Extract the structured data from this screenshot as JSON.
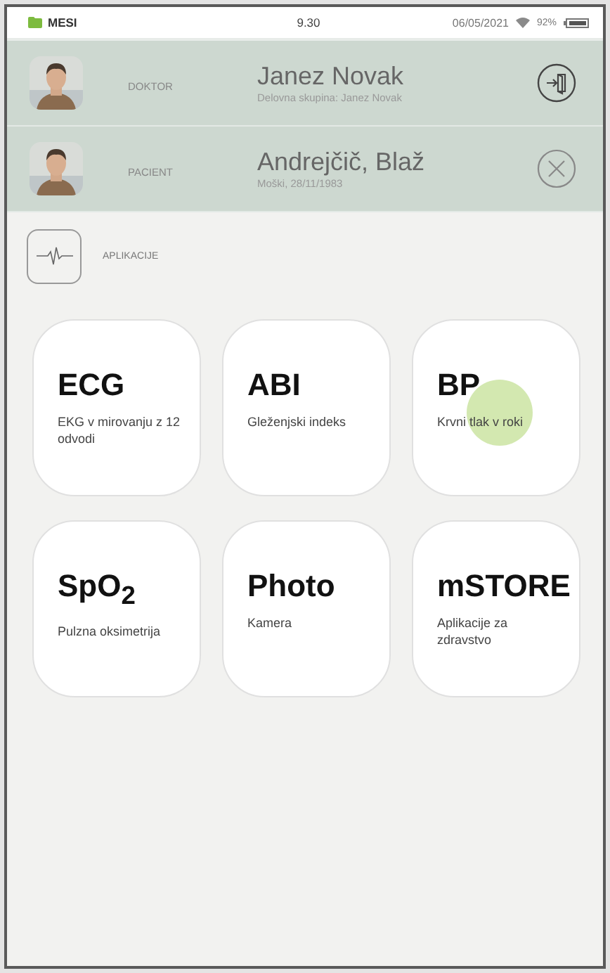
{
  "status_bar": {
    "brand": "MESI",
    "time": "9.30",
    "date": "06/05/2021",
    "battery": "92%"
  },
  "users": [
    {
      "role": "DOKTOR",
      "name": "Janez Novak",
      "detail": "Delovna skupina: Janez Novak",
      "kind": "logout"
    },
    {
      "role": "PACIENT",
      "name": "Andrejčič, Blaž",
      "detail": "Moški, 28/11/1983",
      "kind": "close"
    }
  ],
  "apps_header": {
    "label": "APLIKACIJE"
  },
  "apps": [
    {
      "title": "ECG",
      "subtitle": "EKG v mirovanju z 12 odvodi",
      "touched": false
    },
    {
      "title": "ABI",
      "subtitle": "Gleženjski indeks",
      "touched": false
    },
    {
      "title": "BP",
      "subtitle": "Krvni tlak v roki",
      "touched": true
    },
    {
      "title": "SpO$_{2}$",
      "subtitle": "Pulzna oksimetrija",
      "touched": false
    },
    {
      "title": "Photo",
      "subtitle": "Kamera",
      "touched": false
    },
    {
      "title": "mSTORE",
      "subtitle": "Aplikacije za zdravstvo",
      "touched": false
    }
  ]
}
